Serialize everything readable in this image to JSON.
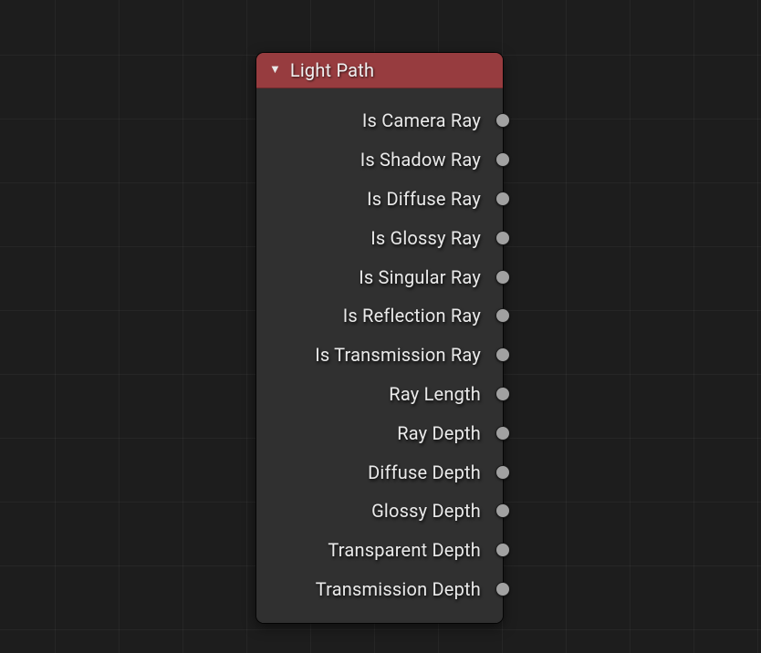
{
  "node": {
    "title": "Light Path",
    "header_color": "#973c3f",
    "outputs": [
      {
        "label": "Is Camera Ray",
        "socket_type": "value"
      },
      {
        "label": "Is Shadow Ray",
        "socket_type": "value"
      },
      {
        "label": "Is Diffuse Ray",
        "socket_type": "value"
      },
      {
        "label": "Is Glossy Ray",
        "socket_type": "value"
      },
      {
        "label": "Is Singular Ray",
        "socket_type": "value"
      },
      {
        "label": "Is Reflection Ray",
        "socket_type": "value"
      },
      {
        "label": "Is Transmission Ray",
        "socket_type": "value"
      },
      {
        "label": "Ray Length",
        "socket_type": "value"
      },
      {
        "label": "Ray Depth",
        "socket_type": "value"
      },
      {
        "label": "Diffuse Depth",
        "socket_type": "value"
      },
      {
        "label": "Glossy Depth",
        "socket_type": "value"
      },
      {
        "label": "Transparent Depth",
        "socket_type": "value"
      },
      {
        "label": "Transmission Depth",
        "socket_type": "value"
      }
    ]
  }
}
